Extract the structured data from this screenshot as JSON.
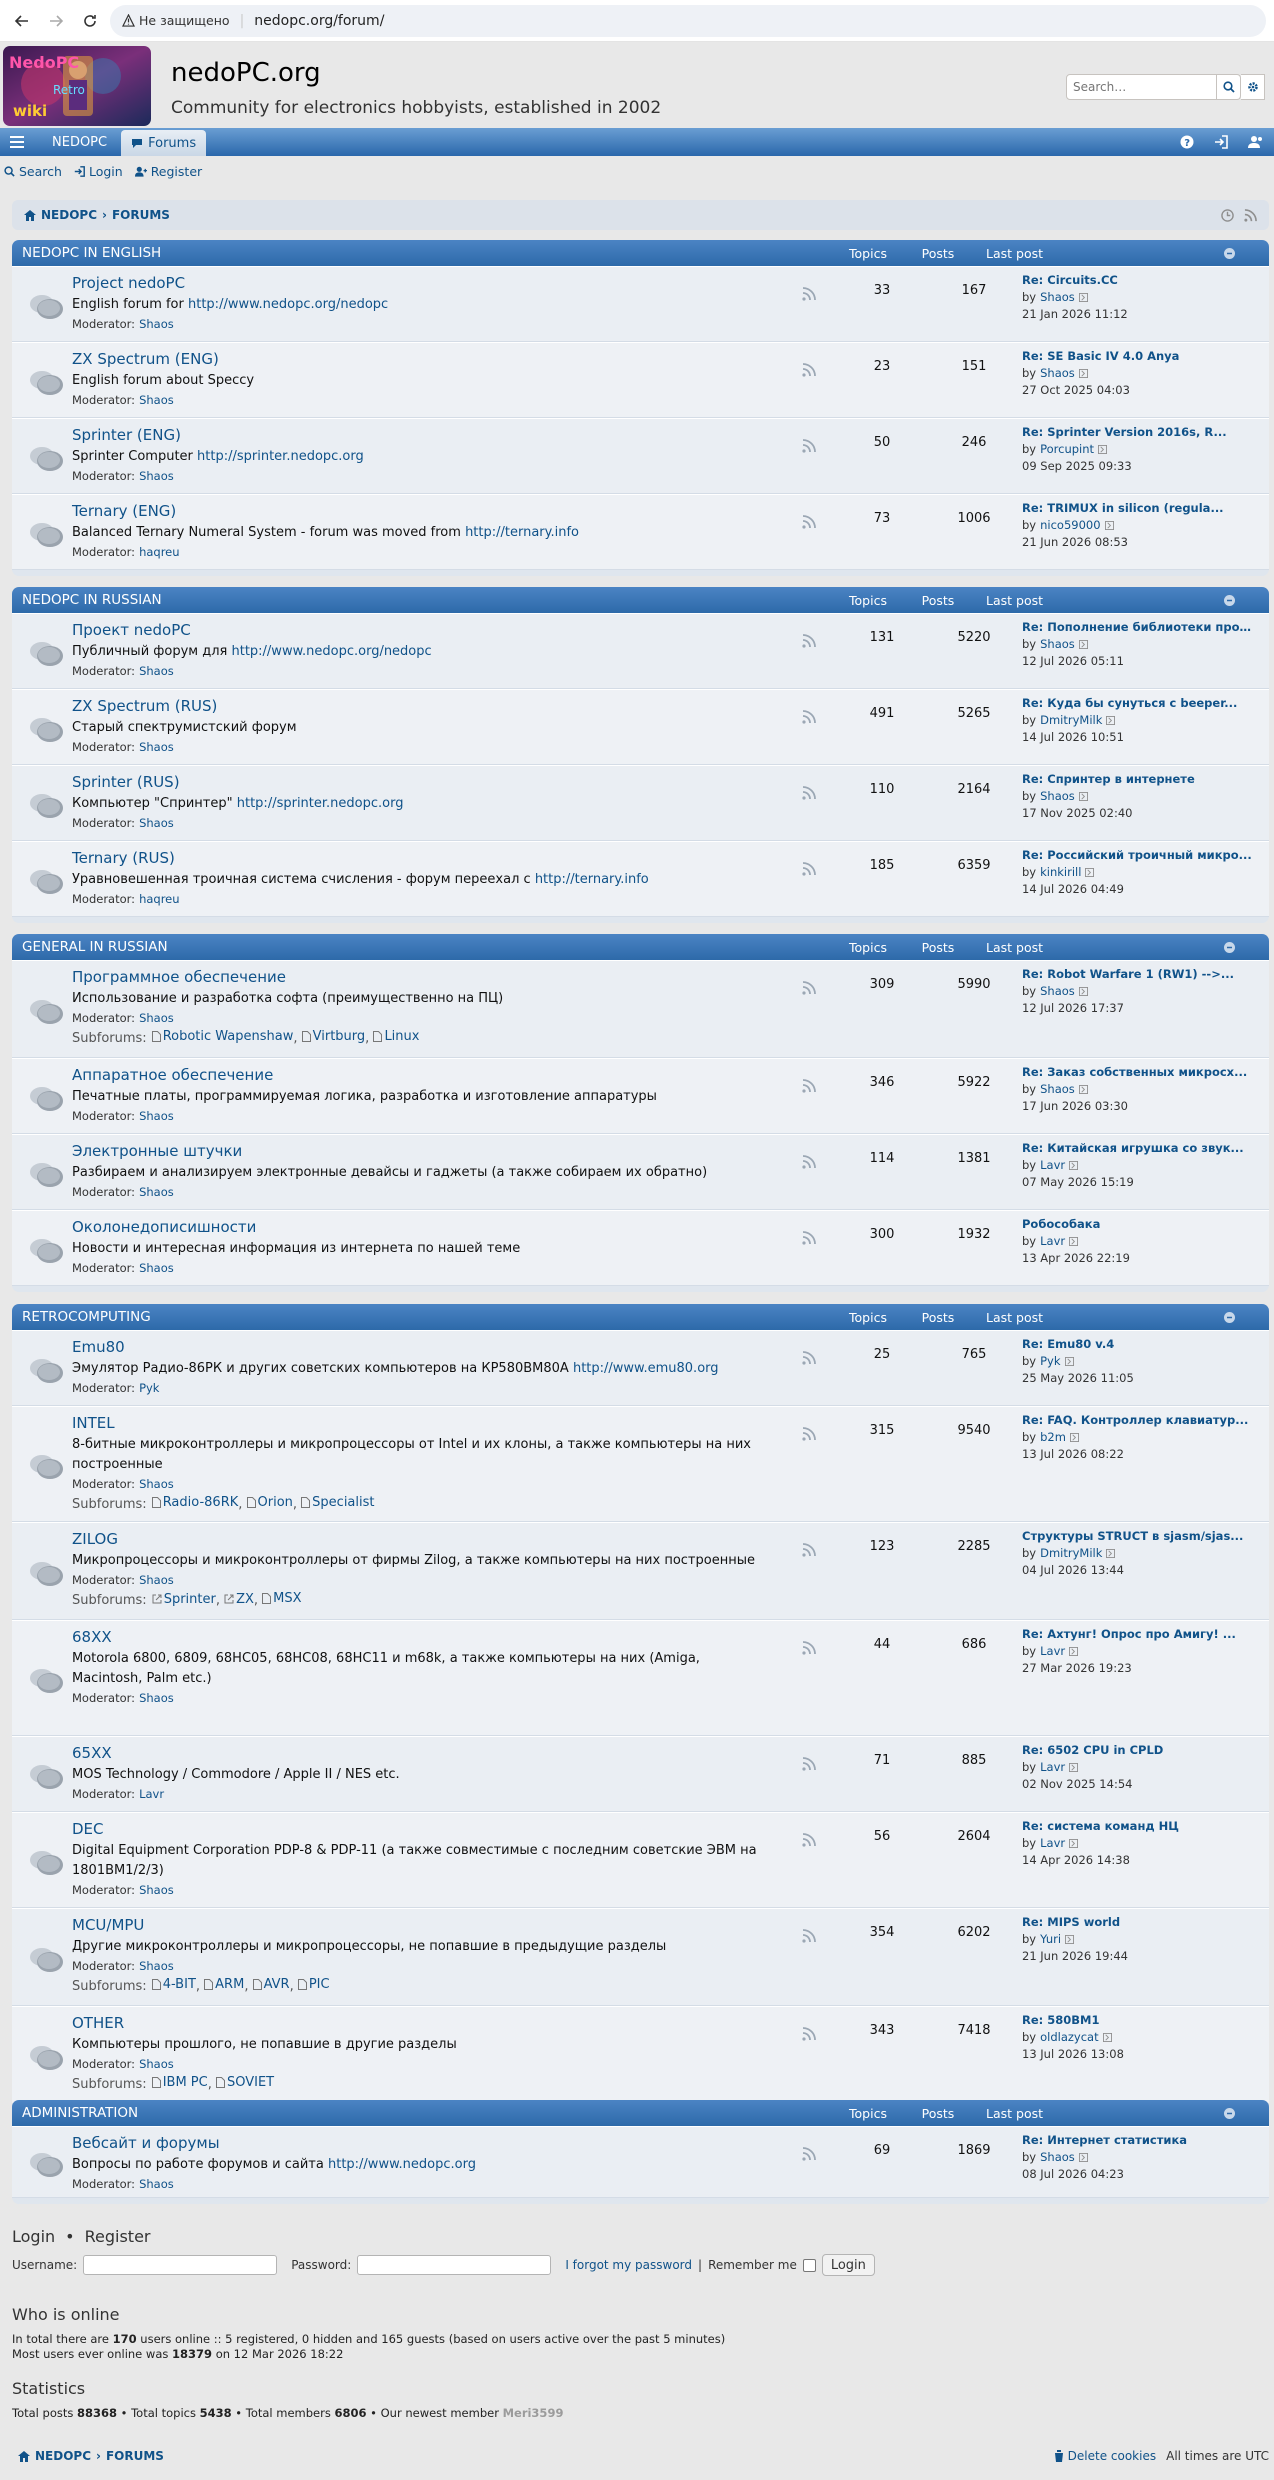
{
  "browser": {
    "security": "Не защищено",
    "url": "nedopc.org/forum/"
  },
  "header": {
    "site_title": "nedoPC.org",
    "site_desc": "Community for electronics hobbyists, established in 2002",
    "search_placeholder": "Search…"
  },
  "navbar": {
    "brand": "NEDOPC",
    "forums": "Forums"
  },
  "subnav": {
    "search": "Search",
    "login": "Login",
    "register": "Register"
  },
  "breadcrumb": {
    "home": "NEDOPC",
    "sep": "›",
    "forums": "FORUMS"
  },
  "columns": {
    "topics": "Topics",
    "posts": "Posts",
    "last_post": "Last post"
  },
  "blocks": [
    {
      "title": "NEDOPC IN ENGLISH",
      "forums": [
        {
          "name": "Project nedoPC",
          "desc": "English forum for ",
          "desc_link": "http://www.nedopc.org/nedopc",
          "mod_label": "Moderator:",
          "mod": "Shaos",
          "topics": "33",
          "posts": "167",
          "lp_title": "Re: Circuits.CC",
          "lp_by": "by",
          "lp_user": "Shaos",
          "lp_date": "21 Jan 2026 11:12"
        },
        {
          "name": "ZX Spectrum (ENG)",
          "desc": "English forum about Speccy",
          "desc_link": "",
          "mod_label": "Moderator:",
          "mod": "Shaos",
          "topics": "23",
          "posts": "151",
          "lp_title": "Re: SE Basic IV 4.0 Anya",
          "lp_by": "by",
          "lp_user": "Shaos",
          "lp_date": "27 Oct 2025 04:03"
        },
        {
          "name": "Sprinter (ENG)",
          "desc": "Sprinter Computer ",
          "desc_link": "http://sprinter.nedopc.org",
          "mod_label": "Moderator:",
          "mod": "Shaos",
          "topics": "50",
          "posts": "246",
          "lp_title": "Re: Sprinter Version 2016s, R...",
          "lp_by": "by",
          "lp_user": "Porcupint",
          "lp_date": "09 Sep 2025 09:33"
        },
        {
          "name": "Ternary (ENG)",
          "desc": "Balanced Ternary Numeral System - forum was moved from ",
          "desc_link": "http://ternary.info",
          "mod_label": "Moderator:",
          "mod": "haqreu",
          "topics": "73",
          "posts": "1006",
          "lp_title": "Re: TRIMUX in silicon (regula...",
          "lp_by": "by",
          "lp_user": "nico59000",
          "lp_date": "21 Jun 2026 08:53"
        }
      ]
    },
    {
      "title": "NEDOPC IN RUSSIAN",
      "forums": [
        {
          "name": "Проект nedoPC",
          "desc": "Публичный форум для ",
          "desc_link": "http://www.nedopc.org/nedopc",
          "mod_label": "Moderator:",
          "mod": "Shaos",
          "topics": "131",
          "posts": "5220",
          "lp_title": "Re: Пополнение библиотеки про...",
          "lp_by": "by",
          "lp_user": "Shaos",
          "lp_date": "12 Jul 2026 05:11"
        },
        {
          "name": "ZX Spectrum (RUS)",
          "desc": "Старый спектрумистский форум",
          "desc_link": "",
          "mod_label": "Moderator:",
          "mod": "Shaos",
          "topics": "491",
          "posts": "5265",
          "lp_title": "Re: Куда бы сунуться с beeper...",
          "lp_by": "by",
          "lp_user": "DmitryMilk",
          "lp_date": "14 Jul 2026 10:51"
        },
        {
          "name": "Sprinter (RUS)",
          "desc": "Компьютер \"Спринтер\" ",
          "desc_link": "http://sprinter.nedopc.org",
          "mod_label": "Moderator:",
          "mod": "Shaos",
          "topics": "110",
          "posts": "2164",
          "lp_title": "Re: Спринтер в интернете",
          "lp_by": "by",
          "lp_user": "Shaos",
          "lp_date": "17 Nov 2025 02:40"
        },
        {
          "name": "Ternary (RUS)",
          "desc": "Уравновешенная троичная система счисления - форум переехал с ",
          "desc_link": "http://ternary.info",
          "mod_label": "Moderator:",
          "mod": "haqreu",
          "topics": "185",
          "posts": "6359",
          "lp_title": "Re: Российский троичный микро...",
          "lp_by": "by",
          "lp_user": "kinkirill",
          "lp_date": "14 Jul 2026 04:49"
        }
      ]
    },
    {
      "title": "GENERAL IN RUSSIAN",
      "forums": [
        {
          "name": "Программное обеспечение",
          "desc": "Использование и разработка софта (преимущественно на ПЦ)",
          "desc_link": "",
          "mod_label": "Moderator:",
          "mod": "Shaos",
          "sub_label": "Subforums:",
          "subs": [
            "Robotic Wapenshaw",
            "Virtburg",
            "Linux"
          ],
          "topics": "309",
          "posts": "5990",
          "lp_title": "Re: Robot Warfare 1 (RW1) -->...",
          "lp_by": "by",
          "lp_user": "Shaos",
          "lp_date": "12 Jul 2026 17:37"
        },
        {
          "name": "Аппаратное обеспечение",
          "desc": "Печатные платы, программируемая логика, разработка и изготовление аппаратуры",
          "desc_link": "",
          "mod_label": "Moderator:",
          "mod": "Shaos",
          "topics": "346",
          "posts": "5922",
          "lp_title": "Re: Заказ собственных микросх...",
          "lp_by": "by",
          "lp_user": "Shaos",
          "lp_date": "17 Jun 2026 03:30"
        },
        {
          "name": "Электронные штучки",
          "desc": "Разбираем и анализируем электронные девайсы и гаджеты (а также собираем их обратно)",
          "desc_link": "",
          "mod_label": "Moderator:",
          "mod": "Shaos",
          "topics": "114",
          "posts": "1381",
          "lp_title": "Re: Китайская игрушка со звук...",
          "lp_by": "by",
          "lp_user": "Lavr",
          "lp_date": "07 May 2026 15:19"
        },
        {
          "name": "Околонедописишности",
          "desc": "Новости и интересная информация из интернета по нашей теме",
          "desc_link": "",
          "mod_label": "Moderator:",
          "mod": "Shaos",
          "topics": "300",
          "posts": "1932",
          "lp_title": "Робособака",
          "lp_by": "by",
          "lp_user": "Lavr",
          "lp_date": "13 Apr 2026 22:19"
        }
      ]
    },
    {
      "title": "RETROCOMPUTING",
      "forums": [
        {
          "name": "Emu80",
          "desc": "Эмулятор Радио-86РК и других советских компьютеров на КР580ВМ80А ",
          "desc_link": "http://www.emu80.org",
          "mod_label": "Moderator:",
          "mod": "Pyk",
          "topics": "25",
          "posts": "765",
          "lp_title": "Re: Emu80 v.4",
          "lp_by": "by",
          "lp_user": "Pyk",
          "lp_date": "25 May 2026 11:05"
        },
        {
          "name": "INTEL",
          "desc": "8-битные микроконтроллеры и микропроцессоры от Intel и их клоны, а также компьютеры на них построенные",
          "desc_link": "",
          "mod_label": "Moderator:",
          "mod": "Shaos",
          "sub_label": "Subforums:",
          "subs": [
            "Radio-86RK",
            "Orion",
            "Specialist"
          ],
          "topics": "315",
          "posts": "9540",
          "lp_title": "Re: FAQ. Контроллер клавиатур...",
          "lp_by": "by",
          "lp_user": "b2m",
          "lp_date": "13 Jul 2026 08:22"
        },
        {
          "name": "ZILOG",
          "desc": "Микропроцессоры и микроконтроллеры от фирмы Zilog, а также компьютеры на них построенные",
          "desc_link": "",
          "mod_label": "Moderator:",
          "mod": "Shaos",
          "sub_label": "Subforums:",
          "subs": [
            "Sprinter",
            "ZX",
            "MSX"
          ],
          "topics": "123",
          "posts": "2285",
          "lp_title": "Структуры STRUCT в sjasm/sjas...",
          "lp_by": "by",
          "lp_user": "DmitryMilk",
          "lp_date": "04 Jul 2026 13:44"
        },
        {
          "name": "68XX",
          "desc": "Motorola 6800, 6809, 68HC05, 68HC08, 68HC11 и m68k, а также компьютеры на них (Amiga, Macintosh, Palm etc.)",
          "desc_link": "",
          "mod_label": "Moderator:",
          "mod": "Shaos",
          "topics": "44",
          "posts": "686",
          "lp_title": "Re: Ахтунг! Опрос про Амигу! ...",
          "lp_by": "by",
          "lp_user": "Lavr",
          "lp_date": "27 Mar 2026 19:23"
        },
        {
          "name": "65XX",
          "desc": "MOS Technology / Commodore / Apple II / NES etc.",
          "desc_link": "",
          "mod_label": "Moderator:",
          "mod": "Lavr",
          "topics": "71",
          "posts": "885",
          "lp_title": "Re: 6502 CPU in CPLD",
          "lp_by": "by",
          "lp_user": "Lavr",
          "lp_date": "02 Nov 2025 14:54"
        },
        {
          "name": "DEC",
          "desc": "Digital Equipment Corporation PDP-8 & PDP-11 (а также совместимые с последним советские ЭВМ на 1801ВМ1/2/3)",
          "desc_link": "",
          "mod_label": "Moderator:",
          "mod": "Shaos",
          "topics": "56",
          "posts": "2604",
          "lp_title": "Re: система команд НЦ",
          "lp_by": "by",
          "lp_user": "Lavr",
          "lp_date": "14 Apr 2026 14:38"
        },
        {
          "name": "MCU/MPU",
          "desc": "Другие микроконтроллеры и микропроцессоры, не попавшие в предыдущие разделы",
          "desc_link": "",
          "mod_label": "Moderator:",
          "mod": "Shaos",
          "sub_label": "Subforums:",
          "subs": [
            "4-BIT",
            "ARM",
            "AVR",
            "PIC"
          ],
          "topics": "354",
          "posts": "6202",
          "lp_title": "Re: MIPS world",
          "lp_by": "by",
          "lp_user": "Yuri",
          "lp_date": "21 Jun 2026 19:44"
        },
        {
          "name": "OTHER",
          "desc": "Компьютеры прошлого, не попавшие в другие разделы",
          "desc_link": "",
          "mod_label": "Moderator:",
          "mod": "Shaos",
          "sub_label": "Subforums:",
          "subs": [
            "IBM PC",
            "SOVIET"
          ],
          "topics": "343",
          "posts": "7418",
          "lp_title": "Re: 580ВМ1",
          "lp_by": "by",
          "lp_user": "oldlazycat",
          "lp_date": "13 Jul 2026 13:08"
        }
      ]
    },
    {
      "title": "ADMINISTRATION",
      "forums": [
        {
          "name": "Вебсайт и форумы",
          "desc": "Вопросы по работе форумов и сайта ",
          "desc_link": "http://www.nedopc.org",
          "mod_label": "Moderator:",
          "mod": "Shaos",
          "topics": "69",
          "posts": "1869",
          "lp_title": "Re: Интернет статистика",
          "lp_by": "by",
          "lp_user": "Shaos",
          "lp_date": "08 Jul 2026 04:23"
        }
      ]
    }
  ],
  "login": {
    "login": "Login",
    "sep": "•",
    "register": "Register",
    "username_label": "Username:",
    "password_label": "Password:",
    "forgot": "I forgot my password",
    "sep2": "|",
    "remember": "Remember me",
    "button": "Login"
  },
  "online": {
    "title": "Who is online",
    "line1_a": "In total there are ",
    "line1_n": "170",
    "line1_b": " users online :: 5 registered, 0 hidden and 165 guests (based on users active over the past 5 minutes)",
    "line2_a": "Most users ever online was ",
    "line2_n": "18379",
    "line2_b": " on 12 Mar 2026 18:22"
  },
  "stats": {
    "title": "Statistics",
    "a": "Total posts ",
    "posts": "88368",
    "b": " • Total topics ",
    "topics": "5438",
    "c": " • Total members ",
    "members": "6806",
    "d": " • Our newest member ",
    "newest": "Meri3599"
  },
  "footer": {
    "home": "NEDOPC",
    "sep": "›",
    "forums": "FORUMS",
    "delete_cookies": "Delete cookies",
    "timezone": "All times are UTC"
  },
  "colors": {
    "link": "#105289",
    "header": "#2d6aa9",
    "bg": "#e8e8e8"
  }
}
